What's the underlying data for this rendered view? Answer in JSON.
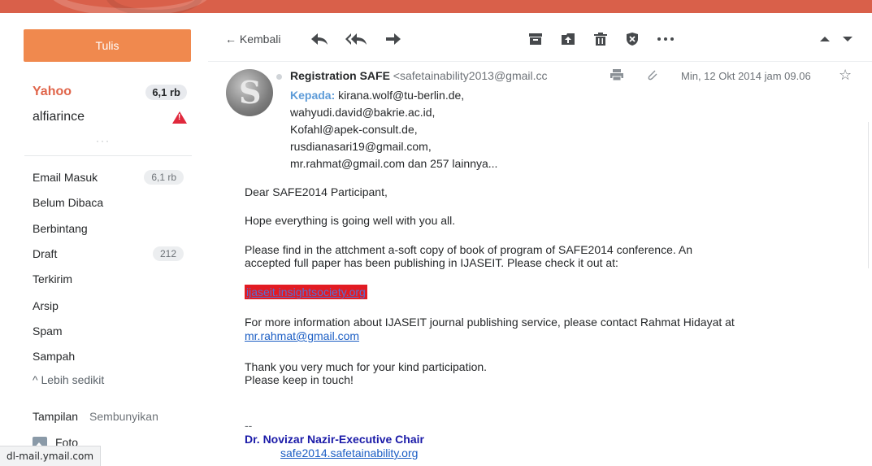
{
  "colors": {
    "brand": "#d9604a",
    "compose": "#f0894e",
    "accent_blue": "#1a5dc4",
    "warning": "#e0283c"
  },
  "sidebar": {
    "compose_label": "Tulis",
    "accounts": [
      {
        "name": "Yahoo",
        "count": "6,1 rb"
      },
      {
        "name": "alfiarince",
        "icon": "warning-icon"
      }
    ],
    "more": "···",
    "folders": [
      {
        "label": "Email Masuk",
        "count": "6,1 rb"
      },
      {
        "label": "Belum Dibaca"
      },
      {
        "label": "Berbintang"
      },
      {
        "label": "Draft",
        "count": "212"
      },
      {
        "label": "Terkirim"
      },
      {
        "label": "Arsip"
      },
      {
        "label": "Spam"
      },
      {
        "label": "Sampah"
      }
    ],
    "less_label": "^ Lebih sedikit",
    "views_label": "Tampilan",
    "hide_label": "Sembunyikan",
    "photo_label": "Foto"
  },
  "statusbar": {
    "text": "dl-mail.ymail.com"
  },
  "toolbar": {
    "back_label": "← Kembali",
    "icons": [
      "reply-icon",
      "reply-all-icon",
      "forward-icon",
      "archive-icon",
      "move-icon",
      "delete-icon",
      "spam-icon",
      "more-icon",
      "prev-icon",
      "next-icon"
    ]
  },
  "message": {
    "sender_name": "Registration SAFE",
    "sender_email": "<safetainability2013@gmail.cc",
    "date": "Min, 12 Okt 2014 jam 09.06",
    "to_label": "Kepada:",
    "recipients": [
      "kirana.wolf@tu-berlin.de,",
      "wahyudi.david@bakrie.ac.id,",
      "Kofahl@apek-consult.de,",
      "rusdianasari19@gmail.com,",
      "mr.rahmat@gmail.com  dan 257 lainnya..."
    ],
    "body": {
      "greeting": "Dear SAFE2014 Participant,",
      "line1": "Hope everything is going well with you all.",
      "line2a": "Please find in the attchment a-soft copy of book of program of SAFE2014 conference.  An",
      "line2b": "accepted full paper has been publishing in IJASEIT.  Please check it out at:",
      "red_link": "ijaseit.insightsociety.org",
      "line3a": "For more information about IJASEIT journal publishing service, please contact Rahmat Hidayat at",
      "line3_link": "mr.rahmat@gmail.com",
      "line4a": "Thank you very much for your kind participation.",
      "line4b": "Please keep in touch!",
      "sig_dash": "--",
      "sig_name": "Dr. Novizar Nazir-Executive Chair",
      "sig_url": "safe2014.safetainability.org"
    }
  }
}
